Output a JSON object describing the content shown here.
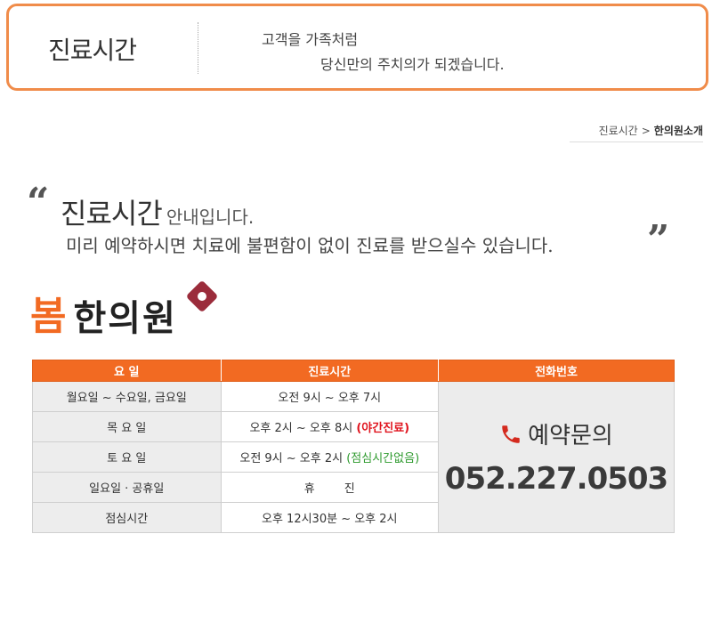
{
  "header": {
    "title": "진료시간",
    "tagline1": "고객을 가족처럼",
    "tagline2": "당신만의 주치의가 되겠습니다."
  },
  "breadcrumb": {
    "parent": "진료시간",
    "separator": ">",
    "current": "한의원소개"
  },
  "intro": {
    "title": "진료시간",
    "title_suffix": "안내입니다.",
    "subtitle": "미리 예약하시면 치료에 불편함이 없이 진료를 받으실수 있습니다."
  },
  "logo": {
    "bom": "봄",
    "rest": "한의원"
  },
  "table": {
    "headers": [
      "요 일",
      "진료시간",
      "전화번호"
    ],
    "rows": [
      {
        "day": "월요일 ~ 수요일, 금요일",
        "hours": "오전 9시  ~  오후 7시",
        "note": ""
      },
      {
        "day": "목 요 일",
        "hours": "오후 2시  ~  오후 8시",
        "note": "(야간진료)"
      },
      {
        "day": "토 요 일",
        "hours": "오전 9시  ~  오후 2시",
        "note": "(점심시간없음)"
      },
      {
        "day": "일요일 · 공휴일",
        "hours": "휴        진",
        "note": ""
      },
      {
        "day": "점심시간",
        "hours": "오후 12시30분 ~ 오후 2시",
        "note": ""
      }
    ],
    "phone_label": "예약문의",
    "phone_number": "052.227.0503"
  },
  "colors": {
    "accent": "#f26a22",
    "border": "#f08c4a",
    "holiday": "#e0141e",
    "green_note": "#2e9a2e"
  }
}
